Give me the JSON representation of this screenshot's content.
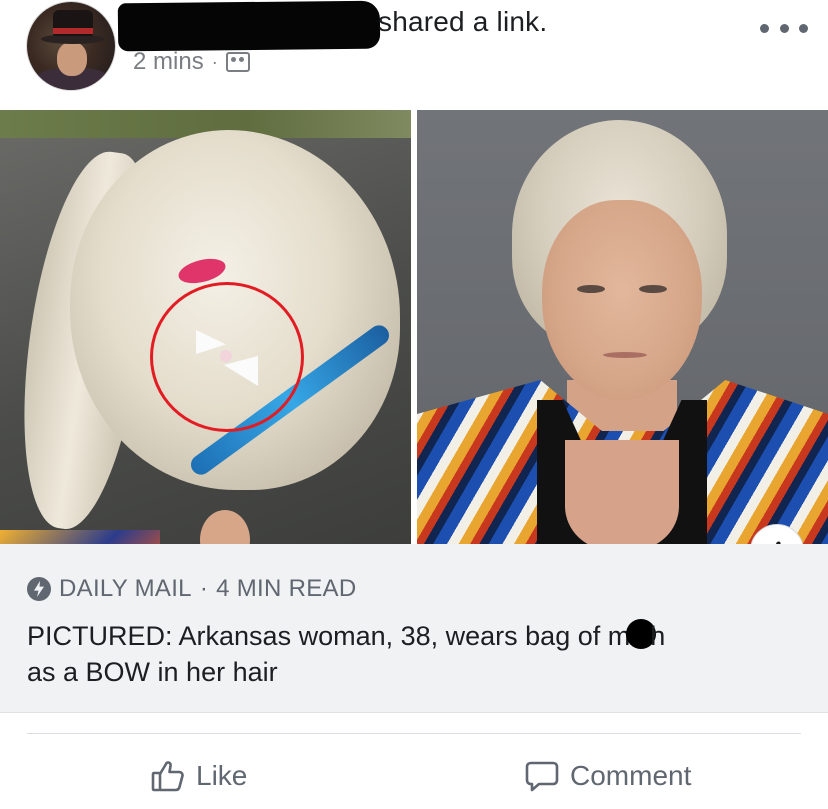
{
  "post": {
    "author_redacted": "",
    "action_text": "shared a link.",
    "time": "2 mins",
    "separator": "·",
    "audience_icon": "friends-icon",
    "more_icon": "more-horizontal-icon"
  },
  "link_preview": {
    "source": "DAILY MAIL",
    "source_separator": "·",
    "read_time": "4 MIN READ",
    "headline_part1": "PICTURED: Arkansas woman, 38, wears bag of m",
    "headline_part2": "h",
    "headline_part3": "as a BOW in her hair",
    "info_label": "i"
  },
  "actions": {
    "like_label": "Like",
    "comment_label": "Comment"
  },
  "colors": {
    "text_primary": "#1c1e21",
    "text_secondary": "#606770",
    "preview_bg": "#f1f2f4",
    "highlight_circle": "#e21c22"
  }
}
